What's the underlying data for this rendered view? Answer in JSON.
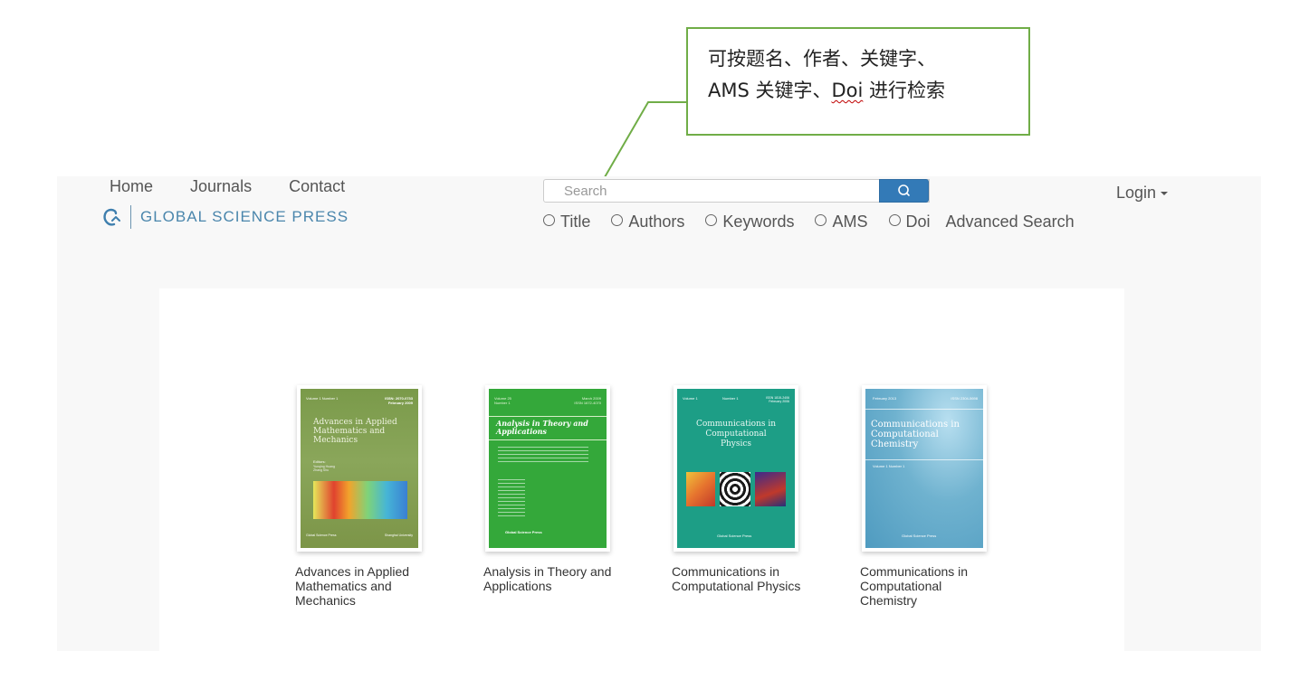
{
  "annotation": {
    "line1": "可按题名、作者、关键字、",
    "line2_prefix": "AMS 关键字、",
    "line2_doi": "Doi",
    "line2_suffix": " 进行检索",
    "border_color": "#70ad47"
  },
  "nav": {
    "home": "Home",
    "journals": "Journals",
    "contact": "Contact"
  },
  "logo": {
    "text": "GLOBAL SCIENCE PRESS"
  },
  "search": {
    "placeholder": "Search",
    "button_icon": "search-icon",
    "options": [
      "Title",
      "Authors",
      "Keywords",
      "AMS",
      "Doi"
    ],
    "advanced_label": "Advanced Search"
  },
  "login": {
    "label": "Login"
  },
  "colors": {
    "search_button": "#337ab7",
    "logo_text": "#4a86ac"
  },
  "journals": [
    {
      "title": "Advances in Applied Mathematics and Mechanics",
      "cover": {
        "top_left": "Volume 1    Number 1",
        "top_right": "ISSN: 2070-0733 February 2009",
        "name": "Advances in Applied Mathematics and Mechanics",
        "editors_label": "Editors:",
        "editors": "Yunqing Huang\nZhang Shu",
        "footer_left": "Global Science Press",
        "footer_right": "Shanghai University"
      }
    },
    {
      "title": "Analysis in Theory and Applications",
      "cover": {
        "top_left": "Volume 25\nNumber 1",
        "top_right": "March 2009\nISSN 1672-4070",
        "name": "Analysis in Theory and Applications",
        "footer": "Global Science Press"
      }
    },
    {
      "title": "Communications in Computational Physics",
      "cover": {
        "top_left": "Volume 1",
        "top_mid": "Number 1",
        "top_right": "ISSN 1815-2406\nFebruary 2006",
        "name": "Communications in Computational Physics",
        "footer": "Global Science Press"
      }
    },
    {
      "title": "Communications in Computational Chemistry",
      "cover": {
        "top_left": "February 2013",
        "top_right": "ISSN 2304-5698",
        "name": "Communications in Computational Chemistry",
        "volume": "Volume 1  Number 1",
        "footer": "Global Science Press"
      }
    }
  ]
}
